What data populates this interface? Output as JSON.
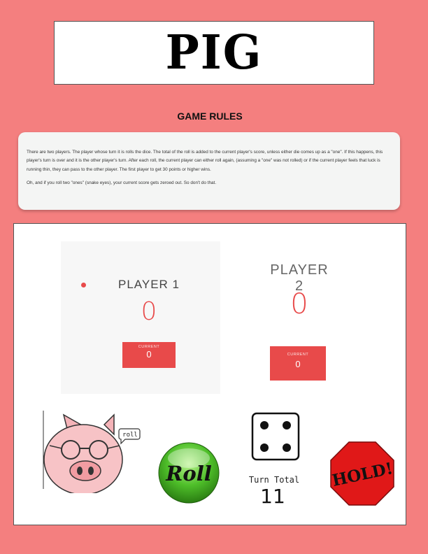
{
  "header": {
    "title": "PIG"
  },
  "rules": {
    "heading": "GAME RULES",
    "paragraph1": "There are two players. The player whose turn it is rolls the dice. The total of the roll is added to the current player's score, unless either die comes up as a \"one\". If this happens, this player's turn is over and it is the other player's turn. After each roll, the current player can either roll again, (assuming a \"one\" was not rolled) or if the current player feels that luck is running thin, they can pass to the other player. The first player to get 30 points or higher wins.",
    "paragraph2": "Oh, and if you roll two \"ones\" (snake eyes), your current score gets zeroed out. So don't do that."
  },
  "players": [
    {
      "name": "PLAYER 1",
      "score": "0",
      "current_label": "CURRENT",
      "current": "0",
      "active": true
    },
    {
      "name": "PLAYER 2",
      "score": "0",
      "current_label": "CURRENT",
      "current": "0",
      "active": false
    }
  ],
  "pig": {
    "speech": "roll",
    "icon": "pig-with-glasses-icon"
  },
  "roll_button": {
    "label": "Roll",
    "icon": "green-roll-button-icon"
  },
  "dice": {
    "value": 4,
    "icon": "die-four-icon"
  },
  "turn_total": {
    "label": "Turn Total",
    "value": "11"
  },
  "hold_button": {
    "label": "HOLD!",
    "icon": "stop-sign-icon"
  },
  "colors": {
    "background": "#f47f7f",
    "accent": "#e84a4a",
    "roll_green": "#3fa81f",
    "hold_red": "#e01818"
  }
}
